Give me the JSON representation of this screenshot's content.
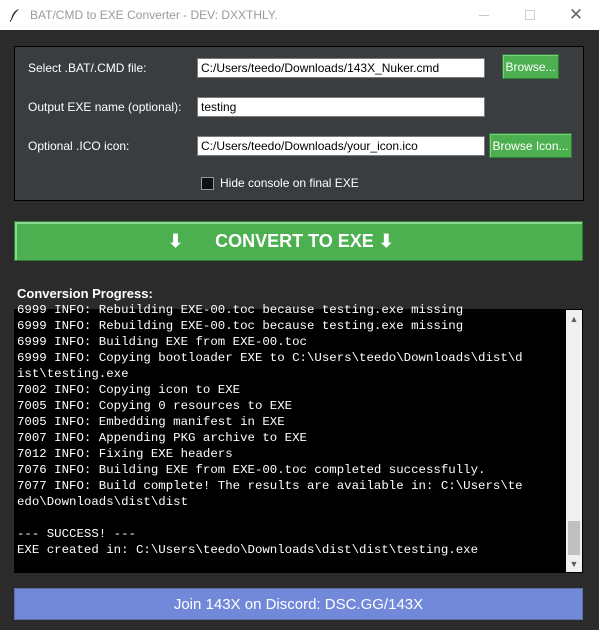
{
  "window": {
    "title": "BAT/CMD to EXE Converter - DEV: DXXTHLY.",
    "close_glyph": "✕"
  },
  "form": {
    "bat_label": "Select .BAT/.CMD file:",
    "bat_value": "C:/Users/teedo/Downloads/143X_Nuker.cmd",
    "browse_label": "Browse...",
    "exe_label": "Output EXE name (optional):",
    "exe_value": "testing",
    "ico_label": "Optional .ICO icon:",
    "ico_value": "C:/Users/teedo/Downloads/your_icon.ico",
    "browse_icon_label": "Browse Icon...",
    "hide_console_label": "Hide console on final EXE",
    "hide_console_checked": false
  },
  "convert": {
    "arrow_left": "⬇",
    "label": "CONVERT TO EXE ⬇"
  },
  "progress": {
    "label": "Conversion Progress:",
    "log_text": "6999 INFO: Rebuilding EXE-00.toc because testing.exe missing\n6999 INFO: Rebuilding EXE-00.toc because testing.exe missing\n6999 INFO: Building EXE from EXE-00.toc\n6999 INFO: Copying bootloader EXE to C:\\Users\\teedo\\Downloads\\dist\\d\nist\\testing.exe\n7002 INFO: Copying icon to EXE\n7005 INFO: Copying 0 resources to EXE\n7005 INFO: Embedding manifest in EXE\n7007 INFO: Appending PKG archive to EXE\n7012 INFO: Fixing EXE headers\n7076 INFO: Building EXE from EXE-00.toc completed successfully.\n7077 INFO: Build complete! The results are available in: C:\\Users\\te\nedo\\Downloads\\dist\\dist\n\n--- SUCCESS! ---\nEXE created in: C:\\Users\\teedo\\Downloads\\dist\\dist\\testing.exe"
  },
  "scroll": {
    "up_glyph": "▲",
    "down_glyph": "▼"
  },
  "footer": {
    "discord_label": "Join 143X on Discord: DSC.GG/143X"
  },
  "colors": {
    "accent_green": "#4caf50",
    "discord": "#7289da",
    "bg": "#2b2b2b",
    "panel": "#3a3d40"
  }
}
